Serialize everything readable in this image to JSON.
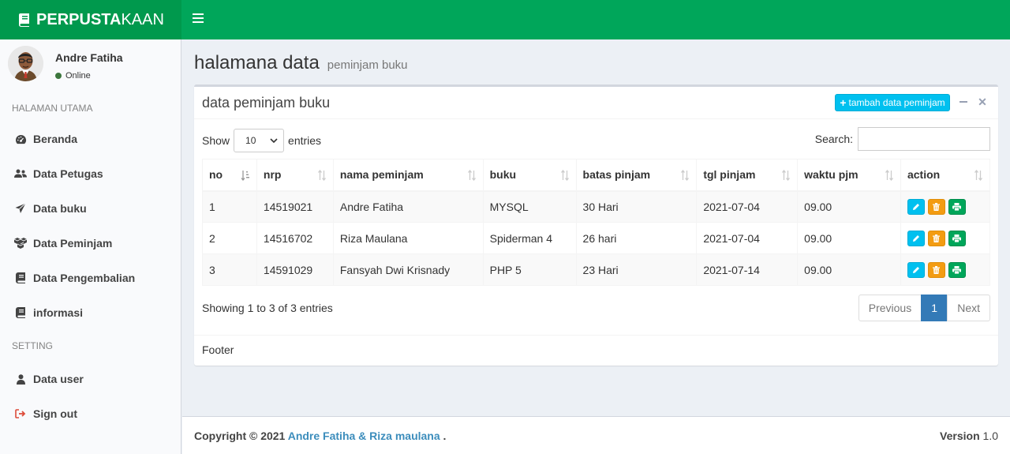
{
  "brand": {
    "bold": "PERPUSTA",
    "light": "KAAN"
  },
  "user": {
    "name": "Andre Fatiha",
    "status": "Online"
  },
  "sidebar": {
    "headers": [
      "HALAMAN UTAMA",
      "SETTING"
    ],
    "main_items": [
      {
        "label": "Beranda",
        "icon": "dashboard-icon"
      },
      {
        "label": "Data Petugas",
        "icon": "users-icon"
      },
      {
        "label": "Data buku",
        "icon": "send-icon"
      },
      {
        "label": "Data Peminjam",
        "icon": "cubes-icon"
      },
      {
        "label": "Data Pengembalian",
        "icon": "book-icon"
      },
      {
        "label": "informasi",
        "icon": "book-icon"
      }
    ],
    "setting_items": [
      {
        "label": "Data user",
        "icon": "user-icon"
      },
      {
        "label": "Sign out",
        "icon": "sign-out-icon"
      }
    ]
  },
  "page": {
    "title": "halamana data",
    "subtitle": "peminjam buku"
  },
  "box": {
    "title": "data peminjam buku",
    "add_button": "tambah data peminjam",
    "footer": "Footer"
  },
  "datatable": {
    "show_label": "Show",
    "entries_label": "entries",
    "page_size": "10",
    "search_label": "Search:",
    "search_value": "",
    "columns": [
      "no",
      "nrp",
      "nama peminjam",
      "buku",
      "batas pinjam",
      "tgl pinjam",
      "waktu pjm",
      "action"
    ],
    "rows": [
      [
        "1",
        "14519021",
        "Andre Fatiha",
        "MYSQL",
        "30 Hari",
        "2021-07-04",
        "09.00"
      ],
      [
        "2",
        "14516702",
        "Riza Maulana",
        "Spiderman 4",
        "26 hari",
        "2021-07-04",
        "09.00"
      ],
      [
        "3",
        "14591029",
        "Fansyah Dwi Krisnady",
        "PHP 5",
        "23 Hari",
        "2021-07-14",
        "09.00"
      ]
    ],
    "info": "Showing 1 to 3 of 3 entries",
    "pagination": {
      "previous": "Previous",
      "current": "1",
      "next": "Next"
    }
  },
  "footer": {
    "copyright": "Copyright © 2021",
    "authors": "Andre Fatiha & Riza maulana",
    "dot": ".",
    "version_label": "Version",
    "version": "1.0"
  },
  "colors": {
    "brand_dark": "#00994d",
    "navbar": "#00a65a",
    "info": "#00c0ef",
    "warning": "#f39c12",
    "success": "#00a65a",
    "primary": "#337ab7"
  }
}
